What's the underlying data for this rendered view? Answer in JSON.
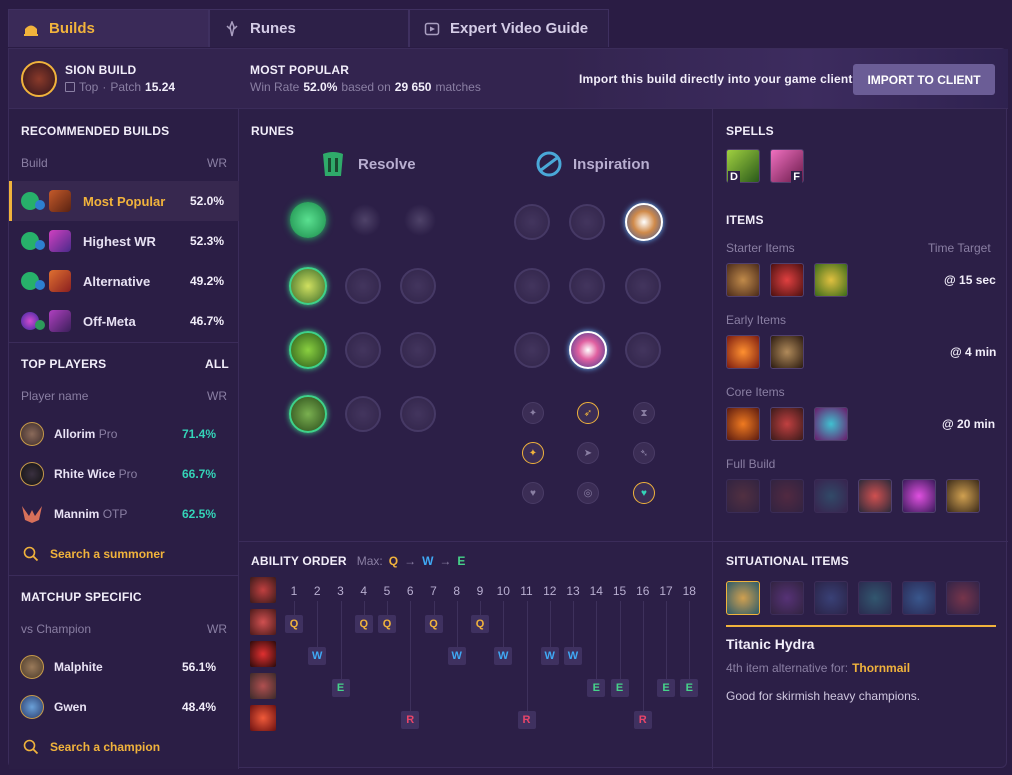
{
  "tabs": [
    {
      "label": "Builds"
    },
    {
      "label": "Runes"
    },
    {
      "label": "Expert Video Guide"
    }
  ],
  "header": {
    "champion": "SION BUILD",
    "role": "Top",
    "patch_label": "Patch",
    "patch": "15.24",
    "popular_title": "MOST POPULAR",
    "winrate_label": "Win Rate",
    "winrate": "52.0%",
    "based_on": "based on",
    "matches": "29 650",
    "matches_label": "matches",
    "import_text": "Import this build directly into your game client:",
    "import_button": "IMPORT TO CLIENT"
  },
  "recommended": {
    "title": "RECOMMENDED BUILDS",
    "col_build": "Build",
    "col_wr": "WR",
    "items": [
      {
        "label": "Most Popular",
        "wr": "52.0%"
      },
      {
        "label": "Highest WR",
        "wr": "52.3%"
      },
      {
        "label": "Alternative",
        "wr": "49.2%"
      },
      {
        "label": "Off-Meta",
        "wr": "46.7%"
      }
    ]
  },
  "top_players": {
    "title": "TOP PLAYERS",
    "all": "ALL",
    "col_name": "Player name",
    "col_wr": "WR",
    "items": [
      {
        "name": "Allorim",
        "tag": "Pro",
        "wr": "71.4%"
      },
      {
        "name": "Rhite Wice",
        "tag": "Pro",
        "wr": "66.7%"
      },
      {
        "name": "Mannim",
        "tag": "OTP",
        "wr": "62.5%"
      }
    ],
    "search": "Search a summoner"
  },
  "matchup": {
    "title": "MATCHUP SPECIFIC",
    "col_name": "vs Champion",
    "col_wr": "WR",
    "items": [
      {
        "name": "Malphite",
        "wr": "56.1%"
      },
      {
        "name": "Gwen",
        "wr": "48.4%"
      }
    ],
    "search": "Search a champion"
  },
  "runes": {
    "title": "RUNES",
    "primary": "Resolve",
    "secondary": "Inspiration"
  },
  "spells": {
    "title": "SPELLS",
    "keys": [
      "D",
      "F"
    ]
  },
  "items": {
    "title": "ITEMS",
    "time_target": "Time Target",
    "groups": [
      {
        "label": "Starter Items",
        "time": "@ 15 sec"
      },
      {
        "label": "Early Items",
        "time": "@ 4 min"
      },
      {
        "label": "Core Items",
        "time": "@ 20 min"
      },
      {
        "label": "Full Build",
        "time": ""
      }
    ]
  },
  "ability": {
    "title": "ABILITY ORDER",
    "max_label": "Max:",
    "max": [
      "Q",
      "W",
      "E"
    ],
    "arrow": "→",
    "levels": [
      "1",
      "2",
      "3",
      "4",
      "5",
      "6",
      "7",
      "8",
      "9",
      "10",
      "11",
      "12",
      "13",
      "14",
      "15",
      "16",
      "17",
      "18"
    ],
    "order": [
      "Q",
      "W",
      "E",
      "Q",
      "Q",
      "R",
      "Q",
      "W",
      "Q",
      "W",
      "R",
      "W",
      "W",
      "E",
      "E",
      "R",
      "E",
      "E"
    ]
  },
  "situational": {
    "title": "SITUATIONAL ITEMS",
    "item_name": "Titanic Hydra",
    "alt_label": "4th item alternative for:",
    "alt_item": "Thornmail",
    "desc": "Good for skirmish heavy champions."
  },
  "colors": {
    "gold": "#f1b33c",
    "teal": "#34d4b8",
    "blue": "#3fa9f5",
    "green": "#46d38a",
    "red": "#e8456a"
  }
}
